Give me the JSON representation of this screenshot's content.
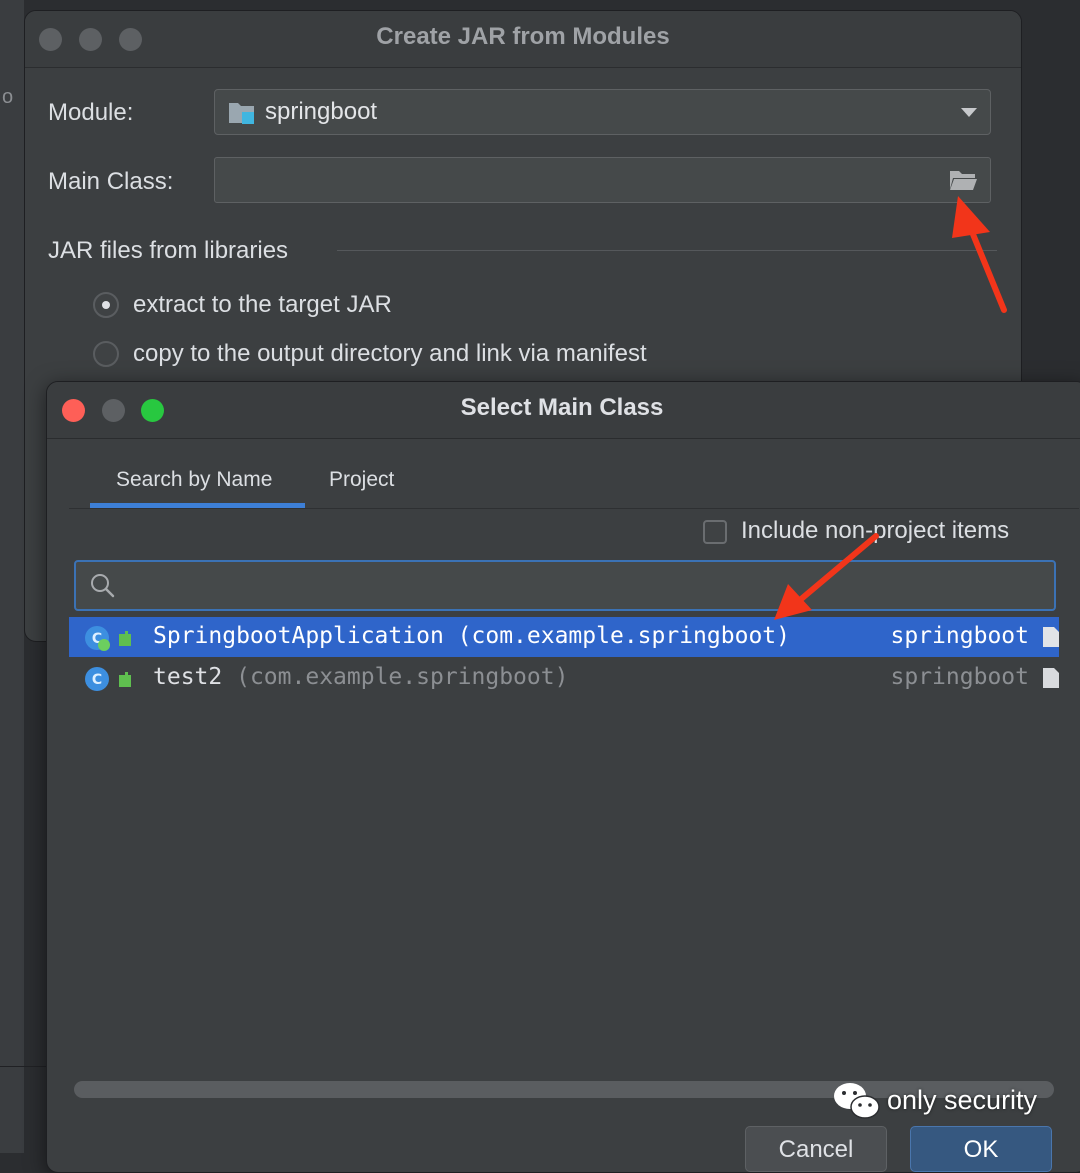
{
  "background": {
    "partial_text": "o"
  },
  "jar_dialog": {
    "title": "Create JAR from Modules",
    "module_label": "Module:",
    "module_value": "springboot",
    "main_class_label": "Main Class:",
    "main_class_value": "",
    "libraries_group_label": "JAR files from libraries",
    "options": [
      {
        "label": "extract to the target JAR",
        "selected": true
      },
      {
        "label": "copy to the output directory and link via manifest",
        "selected": false
      }
    ]
  },
  "main_dialog": {
    "title": "Select Main Class",
    "tabs": [
      {
        "label": "Search by Name",
        "active": true
      },
      {
        "label": "Project",
        "active": false
      }
    ],
    "include_non_project_label": "Include non-project items",
    "include_non_project_checked": false,
    "search_value": "",
    "results": [
      {
        "class_name": "SpringbootApplication",
        "package": "(com.example.springboot)",
        "module": "springboot",
        "selected": true
      },
      {
        "class_name": "test2",
        "package": "(com.example.springboot)",
        "module": "springboot",
        "selected": false
      }
    ],
    "buttons": {
      "cancel": "Cancel",
      "ok": "OK"
    }
  },
  "watermark": {
    "text": "only security"
  },
  "colors": {
    "selection": "#2f65ca",
    "accent_blue": "#3d7fd6",
    "annotation_arrow": "#f2351a",
    "dialog_bg": "#3c3f41"
  }
}
